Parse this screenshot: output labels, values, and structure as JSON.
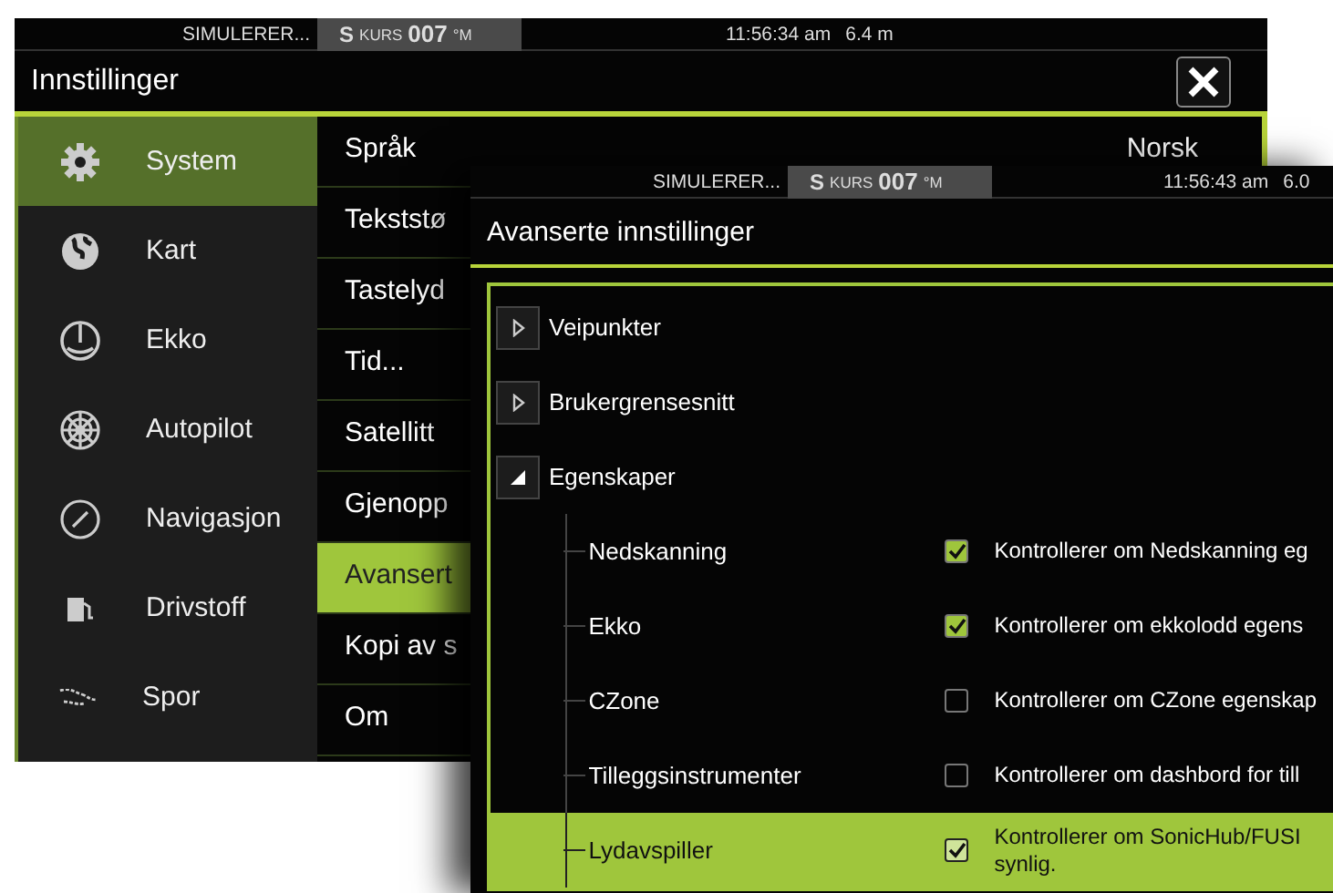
{
  "back_window": {
    "status_bar": {
      "mode": "SIMULERER...",
      "heading_prefix": "S",
      "heading_label": "KURS",
      "heading_value": "007",
      "heading_unit": "°M",
      "time": "11:56:34 am",
      "depth": "6.4 m"
    },
    "title": "Innstillinger",
    "sidebar": [
      {
        "label": "System",
        "selected": true
      },
      {
        "label": "Kart",
        "selected": false
      },
      {
        "label": "Ekko",
        "selected": false
      },
      {
        "label": "Autopilot",
        "selected": false
      },
      {
        "label": "Navigasjon",
        "selected": false
      },
      {
        "label": "Drivstoff",
        "selected": false
      },
      {
        "label": "Spor",
        "selected": false
      }
    ],
    "settings": [
      {
        "label": "Språk",
        "value": "Norsk",
        "selected": false
      },
      {
        "label": "Tekststø",
        "selected": false
      },
      {
        "label": "Tastelyd",
        "selected": false
      },
      {
        "label": "Tid...",
        "selected": false
      },
      {
        "label": "Satellitt",
        "selected": false
      },
      {
        "label": "Gjenopp",
        "selected": false
      },
      {
        "label": "Avansert",
        "selected": true
      },
      {
        "label": "Kopi av s",
        "selected": false
      },
      {
        "label": "Om",
        "selected": false
      }
    ]
  },
  "front_window": {
    "status_bar": {
      "mode": "SIMULERER...",
      "heading_prefix": "S",
      "heading_label": "KURS",
      "heading_value": "007",
      "heading_unit": "°M",
      "time": "11:56:43 am",
      "depth": "6.0"
    },
    "title": "Avanserte innstillinger",
    "tree": [
      {
        "label": "Veipunkter",
        "expanded": false
      },
      {
        "label": "Brukergrensesnitt",
        "expanded": false
      },
      {
        "label": "Egenskaper",
        "expanded": true,
        "children": [
          {
            "label": "Nedskanning",
            "checked": true,
            "description": "Kontrollerer om Nedskanning eg",
            "selected": false
          },
          {
            "label": "Ekko",
            "checked": true,
            "description": "Kontrollerer om ekkolodd egens",
            "selected": false
          },
          {
            "label": "CZone",
            "checked": false,
            "description": "Kontrollerer om CZone egenskap",
            "selected": false
          },
          {
            "label": "Tilleggsinstrumenter",
            "checked": false,
            "description": "Kontrollerer om dashbord for till",
            "selected": false
          },
          {
            "label": "Lydavspiller",
            "checked": true,
            "description": "Kontrollerer om SonicHub/FUSI synlig.",
            "selected": true
          }
        ]
      }
    ]
  }
}
